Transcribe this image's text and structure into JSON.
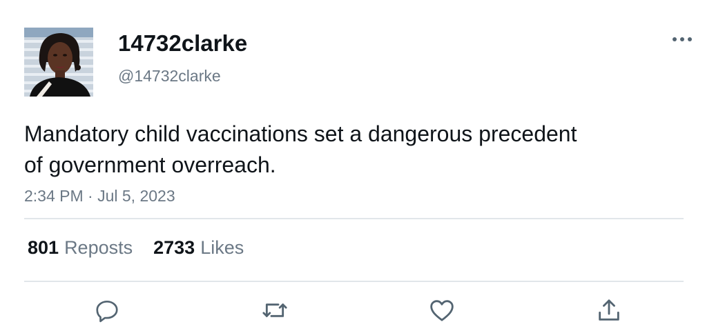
{
  "user": {
    "display_name": "14732clarke",
    "handle": "@14732clarke"
  },
  "tweet": {
    "text_lines": [
      "Mandatory child vaccinations set a dangerous precedent",
      "of government overreach."
    ],
    "timestamp": "2:34 PM · Jul 5, 2023"
  },
  "stats": {
    "reposts_count": "801",
    "reposts_label": "Reposts",
    "likes_count": "2733",
    "likes_label": "Likes"
  },
  "icons": {
    "more": "more-horizontal-icon",
    "reply": "reply-icon",
    "repost": "repost-icon",
    "like": "heart-icon",
    "share": "share-icon"
  },
  "colors": {
    "text": "#0f1419",
    "secondary": "#6b7885",
    "divider": "#e1e6ea",
    "icon": "#536471"
  }
}
